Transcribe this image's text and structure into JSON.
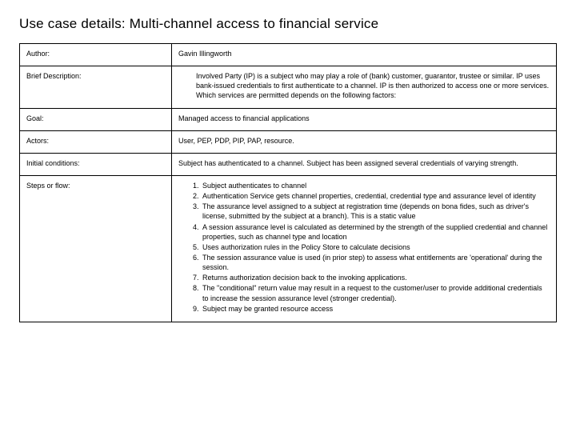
{
  "title": "Use case details: Multi-channel access to financial service",
  "rows": {
    "author": {
      "label": "Author:",
      "value": "Gavin Illingworth"
    },
    "brief": {
      "label": "Brief Description:",
      "value": "Involved Party (IP) is a subject who may play a role of (bank) customer, guarantor, trustee or similar. IP uses bank-issued credentials to first authenticate to a channel. IP is then authorized to access one or more services. Which services are permitted depends on the following factors:"
    },
    "goal": {
      "label": "Goal:",
      "value": "Managed access to  financial applications"
    },
    "actors": {
      "label": "Actors:",
      "value": "User, PEP, PDP, PIP, PAP, resource."
    },
    "initial": {
      "label": "Initial conditions:",
      "value": "Subject has authenticated to a channel. Subject has been assigned several credentials of varying strength."
    },
    "steps": {
      "label": "Steps or flow:",
      "items": [
        "Subject authenticates to channel",
        "Authentication Service gets channel properties, credential, credential type and assurance level of identity",
        "The assurance level assigned to a subject at registration time (depends on bona fides, such as driver's license, submitted by the subject at a branch). This is a static value",
        "A session assurance level is calculated as determined by the strength of the supplied credential and channel properties, such as channel type and location",
        "Uses authorization rules in the Policy Store to calculate decisions",
        "The session assurance value is used (in prior step) to assess what entitlements are 'operational' during the session.",
        "Returns authorization decision back to the invoking applications.",
        "The \"conditional\" return value may result in a request to the customer/user to provide additional credentials to increase the session assurance level (stronger credential).",
        "Subject may be granted resource access"
      ]
    }
  }
}
